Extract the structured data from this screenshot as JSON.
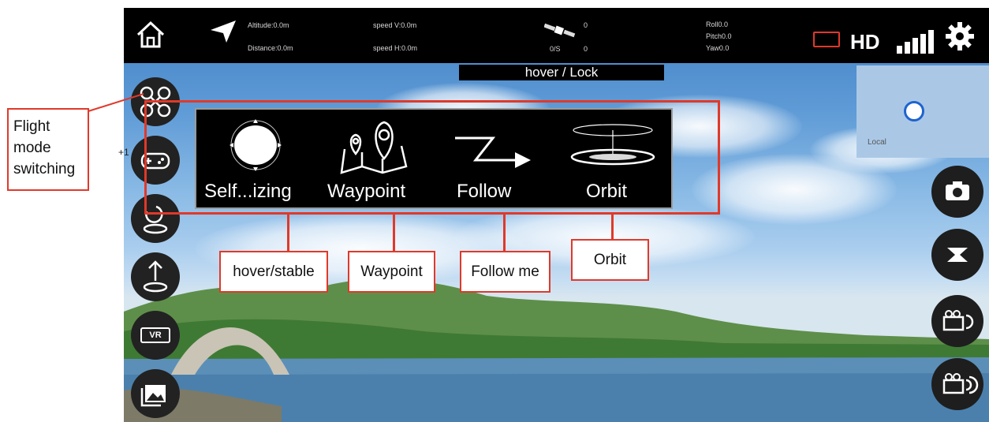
{
  "topbar": {
    "altitude": "Altitude:0.0m",
    "distance": "Distance:0.0m",
    "speed_v": "speed V:0.0m",
    "speed_h": "speed H:0.0m",
    "satellites": "0",
    "gps_rate": "0/S",
    "gps_rate_value": "0",
    "roll": "Roll0.0",
    "pitch": "Pitch0.0",
    "yaw": "Yaw0.0",
    "hd_label": "HD"
  },
  "status_bar": {
    "label": "hover / Lock"
  },
  "minimap": {
    "label": "Local"
  },
  "mode_panel": {
    "modes": [
      {
        "label": "Self...izing",
        "icon": "self-stabilizing-icon"
      },
      {
        "label": "Waypoint",
        "icon": "waypoint-map-icon"
      },
      {
        "label": "Follow",
        "icon": "follow-arrow-icon"
      },
      {
        "label": "Orbit",
        "icon": "orbit-icon"
      }
    ]
  },
  "left_buttons": [
    {
      "icon": "drone-mode-icon"
    },
    {
      "icon": "gamepad-icon",
      "tag": "+1"
    },
    {
      "icon": "drone-takeoff-land-icon"
    },
    {
      "icon": "drone-altitude-icon"
    },
    {
      "icon": "vr-icon",
      "label": "VR"
    },
    {
      "icon": "gallery-icon"
    }
  ],
  "right_buttons": [
    {
      "icon": "camera-photo-icon"
    },
    {
      "icon": "video-record-icon"
    },
    {
      "icon": "camera-rotate-icon"
    },
    {
      "icon": "camera-switch-icon"
    }
  ],
  "annotations": {
    "flight_mode_line1": "Flight",
    "flight_mode_line2": "mode",
    "flight_mode_line3": "switching",
    "callout_1": "hover/stable",
    "callout_2": "Waypoint",
    "callout_3": "Follow me",
    "callout_4": "Orbit"
  },
  "colors": {
    "accent_red": "#e0392a",
    "topbar_bg": "#000000",
    "battery_red": "#e0392a"
  }
}
